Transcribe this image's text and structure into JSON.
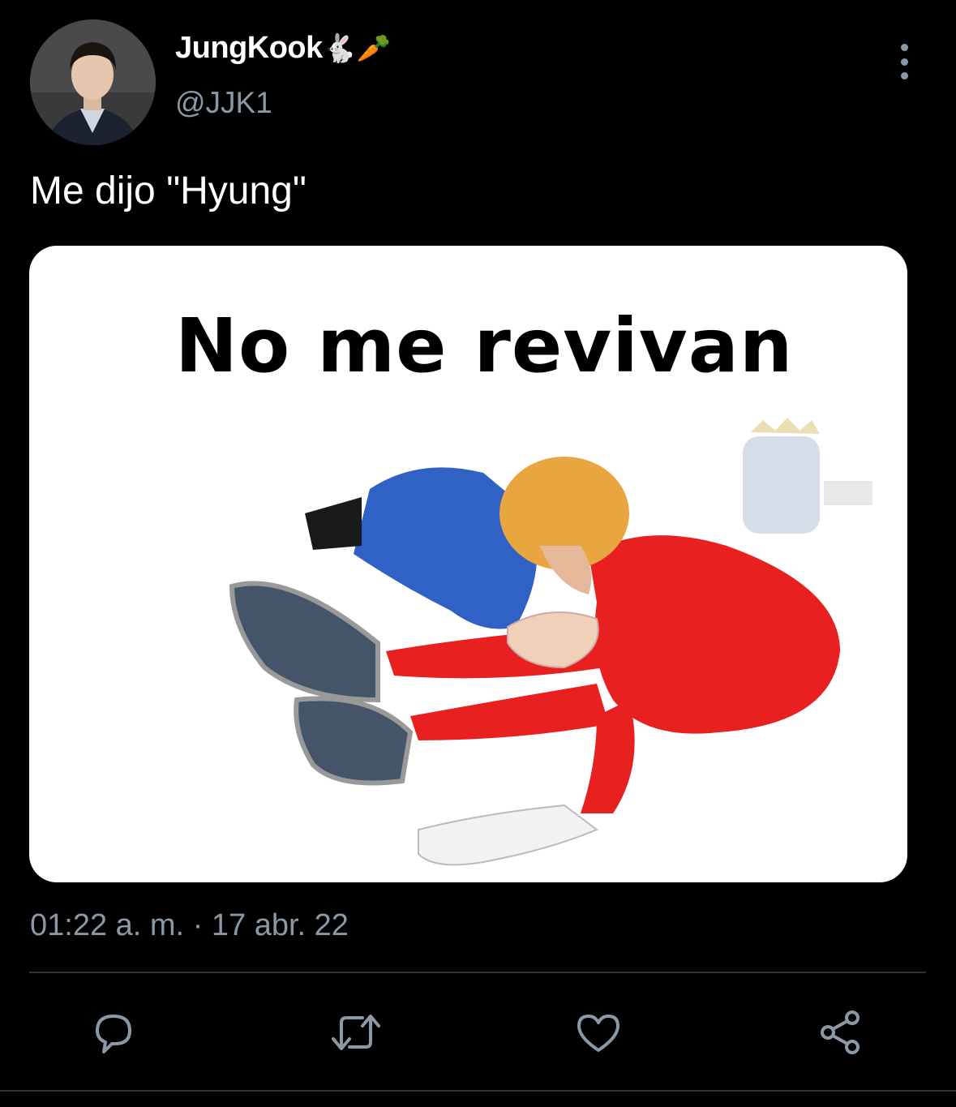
{
  "tweet": {
    "author": {
      "display_name": "JungKook",
      "name_emojis": "🐇🥕",
      "handle": "@JJK1"
    },
    "text": "Me dijo \"Hyung\"",
    "media": {
      "caption": "No me revivan"
    },
    "timestamp": "01:22 a. m. · 17 abr. 22"
  },
  "icons": {
    "more": "more-vertical-icon",
    "reply": "reply-icon",
    "retweet": "retweet-icon",
    "like": "heart-icon",
    "share": "share-icon"
  },
  "colors": {
    "background": "#000000",
    "text_primary": "#ffffff",
    "text_secondary": "#8b98a5",
    "divider": "#2f3336"
  }
}
